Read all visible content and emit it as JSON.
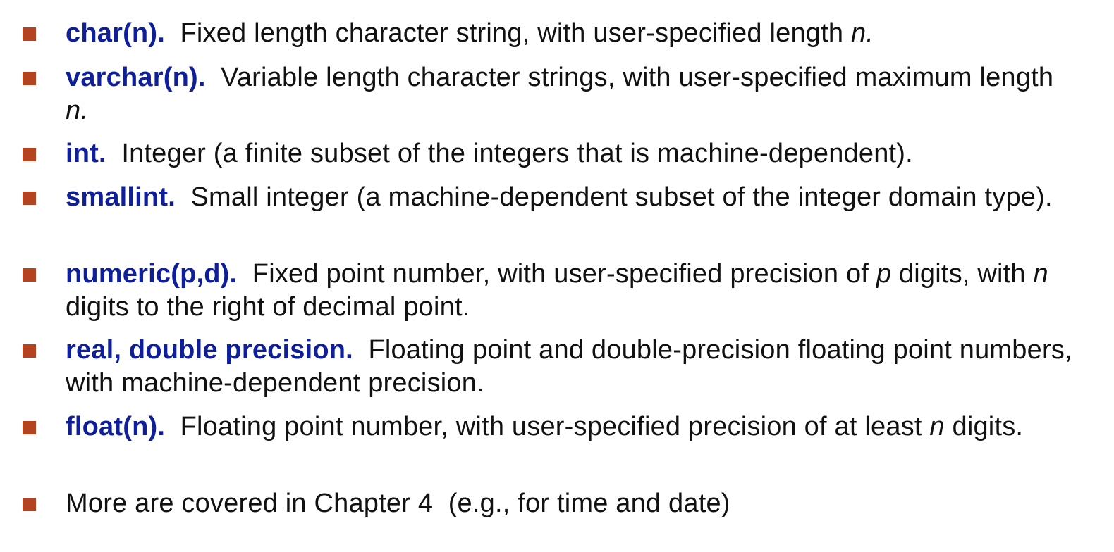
{
  "items": [
    {
      "term": "char(n).",
      "parts": [
        "Fixed length character string, with user-specified length ",
        "n."
      ]
    },
    {
      "term": "varchar(n).",
      "parts": [
        "Variable length character strings, with user-specified maximum length ",
        "n."
      ]
    },
    {
      "term": "int.",
      "parts": [
        "Integer (a finite subset of the integers that is machine-dependent)."
      ]
    },
    {
      "term": "smallint.",
      "parts": [
        "Small integer (a machine-dependent subset of the integer domain type)."
      ]
    },
    {
      "term": "numeric(p,d).",
      "parts": [
        "Fixed point number, with user-specified precision of ",
        "p",
        " digits, with ",
        "n",
        " digits to the right of decimal point."
      ]
    },
    {
      "term": "real, double precision.",
      "parts": [
        "Floating point and double-precision floating point numbers, with machine-dependent precision."
      ]
    },
    {
      "term": "float(n).",
      "parts": [
        "Floating point number, with user-specified precision of at least ",
        "n",
        " digits."
      ]
    },
    {
      "text": "More are covered in Chapter 4  (e.g., for time and date)"
    }
  ],
  "colors": {
    "term": "#0f1f99",
    "bullet": "#b5431f",
    "text": "#111111"
  }
}
